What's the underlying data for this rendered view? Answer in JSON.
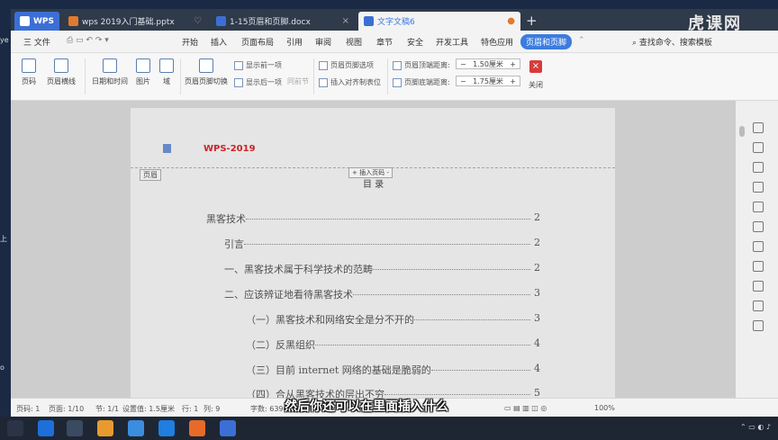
{
  "tabs": [
    {
      "label": "WPS",
      "color": "#3c6fd6"
    },
    {
      "label": "wps 2019入门基础.pptx",
      "color": "#e07a2e"
    },
    {
      "label": "1-15页眉和页脚.docx",
      "color": "#3c6fd6"
    },
    {
      "label": "文字文稿6",
      "color": "#3c6fd6"
    }
  ],
  "watermark": "虎课网",
  "menu": {
    "file": "三 文件",
    "items": [
      "开始",
      "插入",
      "页面布局",
      "引用",
      "审阅",
      "视图",
      "章节",
      "安全",
      "开发工具",
      "特色应用"
    ],
    "selected": "页眉和页脚",
    "search": "查找命令、搜索模板"
  },
  "ribbon": {
    "page_number": "页码",
    "header_border": "页眉横线",
    "date_time": "日期和时间",
    "picture": "图片",
    "field": "域",
    "header_footer_switch": "页眉页脚切换",
    "show_prev": "显示前一项",
    "show_next": "显示后一项",
    "same_as_prev": "同前节",
    "header_footer_options": "页眉页脚选项",
    "insert_align_tab": "插入对齐制表位",
    "header_top_label": "页眉顶端距离:",
    "header_top_value": "1.50厘米",
    "footer_bottom_label": "页脚底端距离:",
    "footer_bottom_value": "1.75厘米",
    "close": "关闭"
  },
  "page": {
    "header_text": "WPS-2019",
    "header_label": "页眉",
    "insert_page_number": "+ 插入页码 -",
    "contents_title": "目 录",
    "toc": [
      {
        "text": "黑客技术",
        "page": "2",
        "indent": 0
      },
      {
        "text": "引言",
        "page": "2",
        "indent": 1
      },
      {
        "text": "一、黑客技术属于科学技术的范畴",
        "page": "2",
        "indent": 1
      },
      {
        "text": "二、应该辨证地看待黑客技术",
        "page": "3",
        "indent": 1
      },
      {
        "text": "（一）黑客技术和网络安全是分不开的",
        "page": "3",
        "indent": 2
      },
      {
        "text": "（二）反黑组织",
        "page": "4",
        "indent": 2
      },
      {
        "text": "（三）目前 internet 网络的基础是脆弱的",
        "page": "4",
        "indent": 2
      },
      {
        "text": "（四）合从黑客技术的层出不穷",
        "page": "5",
        "indent": 2
      }
    ]
  },
  "status": {
    "page": "页码: 1",
    "pages": "页面: 1/10",
    "section": "节: 1/1",
    "setting": "设置值: 1.5厘米",
    "row": "行: 1",
    "col": "列: 9",
    "words": "字数: 6390",
    "zoom": "100%"
  },
  "subtitle": "然后你还可以在里面插入什么",
  "desktop": [
    "ye",
    "上",
    "o"
  ],
  "colors": {
    "accent": "#3c7ce0",
    "header_red": "#d4252b",
    "close_red": "#d83b3b"
  }
}
